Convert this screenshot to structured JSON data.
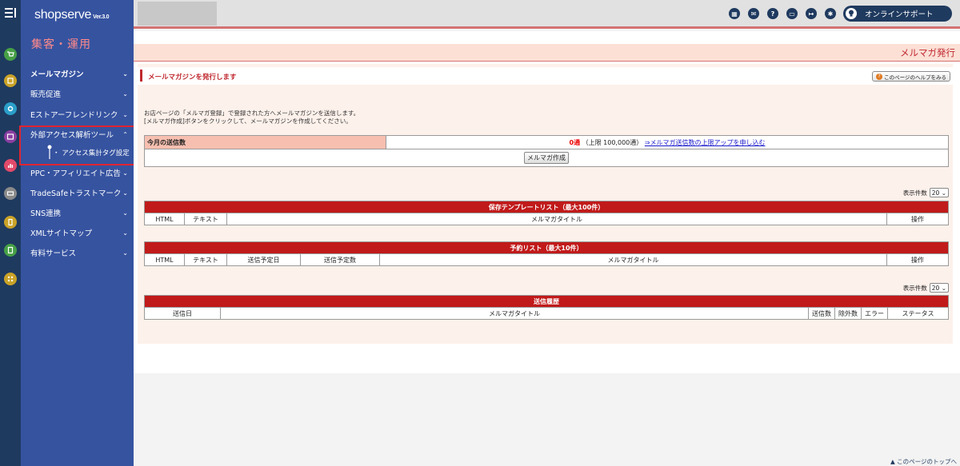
{
  "sidebar": {
    "logo": "shopserve",
    "logo_version": "Ver.3.0",
    "section_title": "集客・運用",
    "items": [
      {
        "label": "メールマガジン"
      },
      {
        "label": "販売促進"
      },
      {
        "label": "Eストアーフレンドリンク"
      },
      {
        "label": "外部アクセス解析ツール"
      },
      {
        "label": "PPC・アフィリエイト広告"
      },
      {
        "label": "TradeSafeトラストマーク"
      },
      {
        "label": "SNS連携"
      },
      {
        "label": "XMLサイトマップ"
      },
      {
        "label": "有料サービス"
      }
    ],
    "sub_item": "・ アクセス集計タグ設定"
  },
  "topbar": {
    "support_label": "オンラインサポート",
    "icons": [
      "store-icon",
      "mail-icon",
      "help-icon",
      "chat-icon",
      "logout-icon",
      "settings-icon"
    ]
  },
  "page": {
    "title": "メルマガ発行",
    "subtitle": "メールマガジンを発行します",
    "help_button": "このページのヘルプをみる",
    "info_line1": "お店ページの「メルマガ登録」で登録された方へメールマガジンを送信します。",
    "info_line2": "[メルマガ作成]ボタンをクリックして、メールマガジンを作成してください。"
  },
  "send_status": {
    "label": "今月の送信数",
    "count": "0通",
    "limit": "（上限 100,000通）",
    "upgrade_link": "⇒メルマガ送信数の上限アップを申し込む",
    "create_button": "メルマガ作成"
  },
  "per_page": {
    "label": "表示件数",
    "value": "20"
  },
  "template_list": {
    "caption": "保存テンプレートリスト（最大100件）",
    "columns": [
      "HTML",
      "テキスト",
      "メルマガタイトル",
      "操作"
    ]
  },
  "reserve_list": {
    "caption": "予約リスト（最大10件）",
    "columns": [
      "HTML",
      "テキスト",
      "送信予定日",
      "送信予定数",
      "メルマガタイトル",
      "操作"
    ]
  },
  "history_list": {
    "caption": "送信履歴",
    "columns": [
      "送信日",
      "メルマガタイトル",
      "送信数",
      "除外数",
      "エラー",
      "ステータス"
    ]
  },
  "footer": {
    "back_to_top": "▲ このページのトップへ"
  },
  "colors": {
    "rail": "#1f3a5f",
    "sidebar": "#3653a0",
    "accent_red": "#c11a1a",
    "section_pink": "#ff8a8a"
  }
}
